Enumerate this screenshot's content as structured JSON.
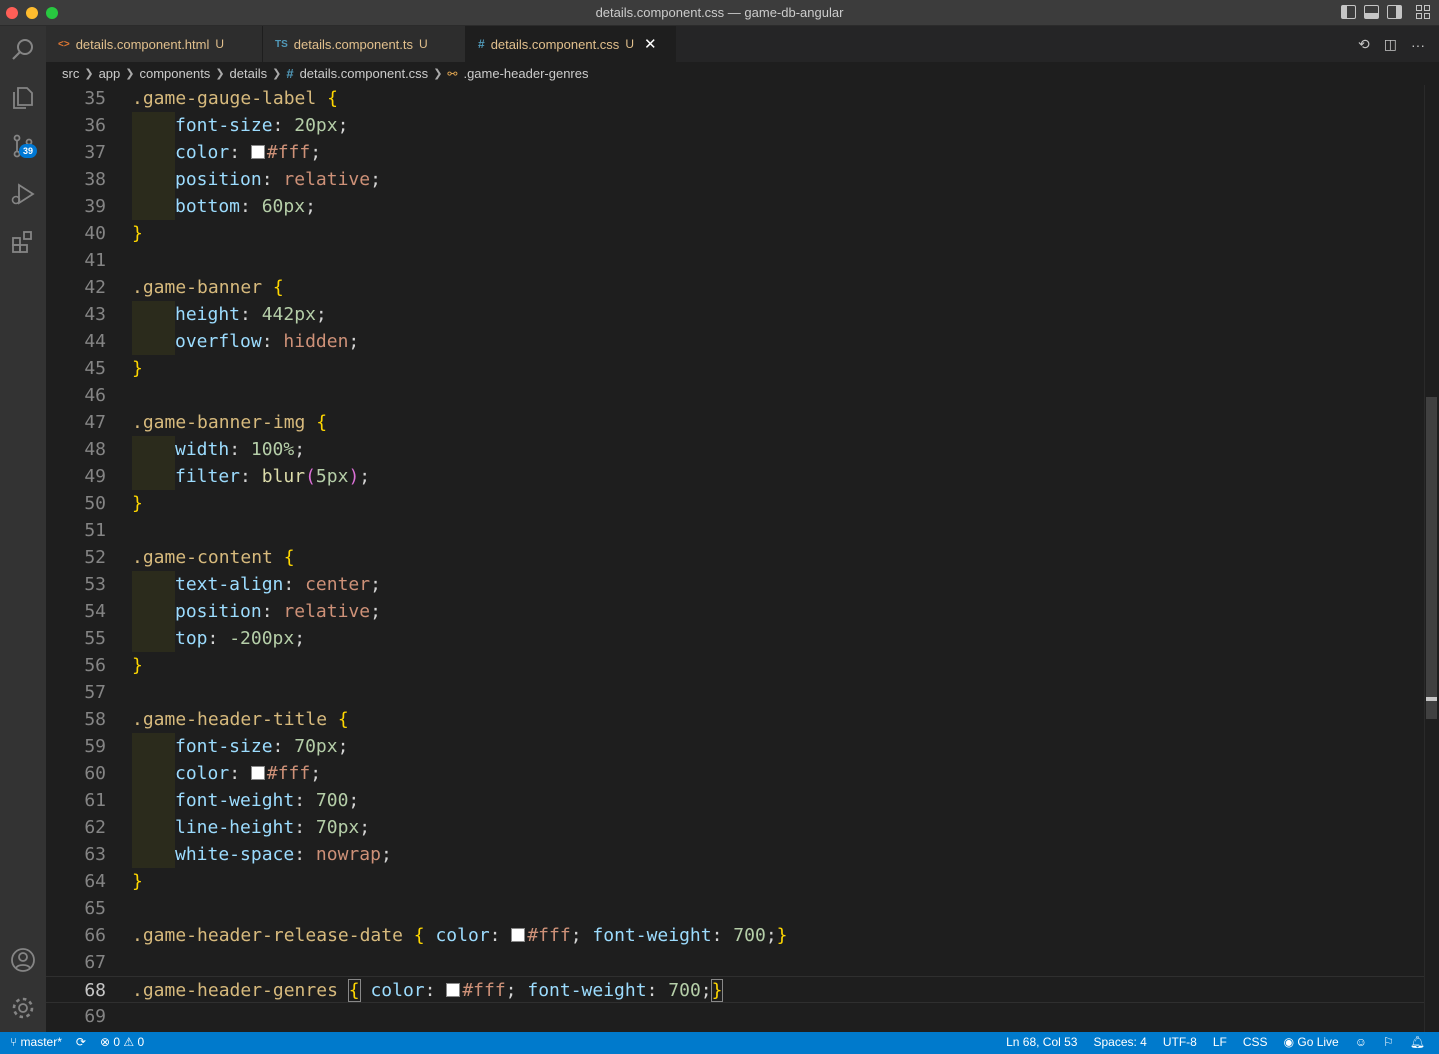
{
  "window": {
    "title": "details.component.css — game-db-angular"
  },
  "activity_bar": {
    "source_control_badge": "39",
    "icons": [
      "search-icon",
      "explorer-icon",
      "source-control-icon",
      "run-debug-icon",
      "extensions-icon",
      "account-icon",
      "settings-gear-icon"
    ]
  },
  "tabs": [
    {
      "icon": "<>",
      "icon_color": "#e37933",
      "label": "details.component.html",
      "status": "U",
      "active": false
    },
    {
      "icon": "TS",
      "icon_color": "#519aba",
      "label": "details.component.ts",
      "status": "U",
      "active": false
    },
    {
      "icon": "#",
      "icon_color": "#519aba",
      "label": "details.component.css",
      "status": "U",
      "active": true
    }
  ],
  "tab_actions": {
    "more_label": "···"
  },
  "breadcrumb": {
    "items": [
      "src",
      "app",
      "components",
      "details",
      "details.component.css",
      ".game-header-genres"
    ]
  },
  "editor": {
    "current_line": 68,
    "line_numbers": [
      "35",
      "36",
      "37",
      "38",
      "39",
      "40",
      "41",
      "42",
      "43",
      "44",
      "45",
      "46",
      "47",
      "48",
      "49",
      "50",
      "51",
      "52",
      "53",
      "54",
      "55",
      "56",
      "57",
      "58",
      "59",
      "60",
      "61",
      "62",
      "63",
      "64",
      "65",
      "66",
      "67",
      "68",
      "69"
    ],
    "code": {
      "l35_sel": ".game-gauge-label",
      "l36_prop": "font-size",
      "l36_val": "20px",
      "l37_prop": "color",
      "l37_val": "#fff",
      "l38_prop": "position",
      "l38_val": "relative",
      "l39_prop": "bottom",
      "l39_val": "60px",
      "l42_sel": ".game-banner",
      "l43_prop": "height",
      "l43_val": "442px",
      "l44_prop": "overflow",
      "l44_val": "hidden",
      "l47_sel": ".game-banner-img",
      "l48_prop": "width",
      "l48_val": "100%",
      "l49_prop": "filter",
      "l49_fn": "blur",
      "l49_arg": "5px",
      "l52_sel": ".game-content",
      "l53_prop": "text-align",
      "l53_val": "center",
      "l54_prop": "position",
      "l54_val": "relative",
      "l55_prop": "top",
      "l55_val": "-200px",
      "l58_sel": ".game-header-title",
      "l59_prop": "font-size",
      "l59_val": "70px",
      "l60_prop": "color",
      "l60_val": "#fff",
      "l61_prop": "font-weight",
      "l61_val": "700",
      "l62_prop": "line-height",
      "l62_val": "70px",
      "l63_prop": "white-space",
      "l63_val": "nowrap",
      "l66_sel": ".game-header-release-date",
      "l66_prop1": "color",
      "l66_val1": "#fff",
      "l66_prop2": "font-weight",
      "l66_val2": "700",
      "l68_sel": ".game-header-genres",
      "l68_prop1": "color",
      "l68_val1": "#fff",
      "l68_prop2": "font-weight",
      "l68_val2": "700"
    }
  },
  "status_bar": {
    "branch": "master*",
    "errors": "0",
    "warnings": "0",
    "cursor": "Ln 68, Col 53",
    "spaces": "Spaces: 4",
    "encoding": "UTF-8",
    "eol": "LF",
    "language": "CSS",
    "go_live": "Go Live"
  },
  "colors": {
    "status_bar": "#007acc",
    "activity_bar": "#333333",
    "editor_bg": "#1e1e1e",
    "selector": "#d7ba7d",
    "property": "#9cdcfe",
    "number": "#b5cea8",
    "keyword_value": "#ce9178",
    "brace": "#ffd700"
  }
}
